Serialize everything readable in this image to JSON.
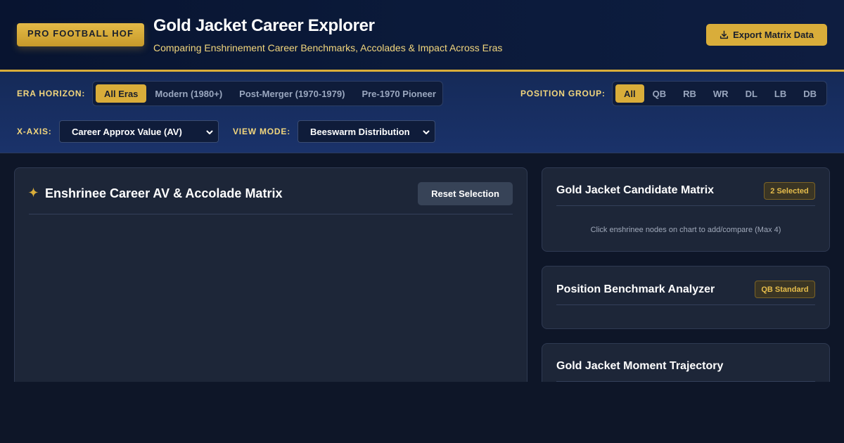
{
  "header": {
    "brand": "PRO FOOTBALL HOF",
    "title": "Gold Jacket Career Explorer",
    "subtitle": "Comparing Enshrinement Career Benchmarks, Accolades & Impact Across Eras",
    "export_label": "Export Matrix Data",
    "export_icon": "download-icon"
  },
  "filters": {
    "era_label": "ERA HORIZON:",
    "eras": [
      {
        "label": "All Eras",
        "active": true
      },
      {
        "label": "Modern (1980+)",
        "active": false
      },
      {
        "label": "Post-Merger (1970-1979)",
        "active": false
      },
      {
        "label": "Pre-1970 Pioneer",
        "active": false
      }
    ],
    "position_label": "POSITION GROUP:",
    "positions": [
      {
        "label": "All",
        "active": true
      },
      {
        "label": "QB",
        "active": false
      },
      {
        "label": "RB",
        "active": false
      },
      {
        "label": "WR",
        "active": false
      },
      {
        "label": "DL",
        "active": false
      },
      {
        "label": "LB",
        "active": false
      },
      {
        "label": "DB",
        "active": false
      }
    ],
    "xaxis_label": "X-AXIS:",
    "xaxis_value": "Career Approx Value (AV)",
    "viewmode_label": "VIEW MODE:",
    "viewmode_value": "Beeswarm Distribution"
  },
  "matrix_card": {
    "icon": "sparkle-icon",
    "title": "Enshrinee Career AV & Accolade Matrix",
    "reset_label": "Reset Selection"
  },
  "candidate_card": {
    "title": "Gold Jacket Candidate Matrix",
    "badge": "2 Selected",
    "hint": "Click enshrinee nodes on chart to add/compare (Max 4)"
  },
  "benchmark_card": {
    "title": "Position Benchmark Analyzer",
    "badge": "QB Standard"
  },
  "trajectory_card": {
    "title": "Gold Jacket Moment Trajectory"
  },
  "colors": {
    "accent_gold": "#d9ad3a",
    "background": "#0e1628",
    "card": "#1d2638"
  }
}
